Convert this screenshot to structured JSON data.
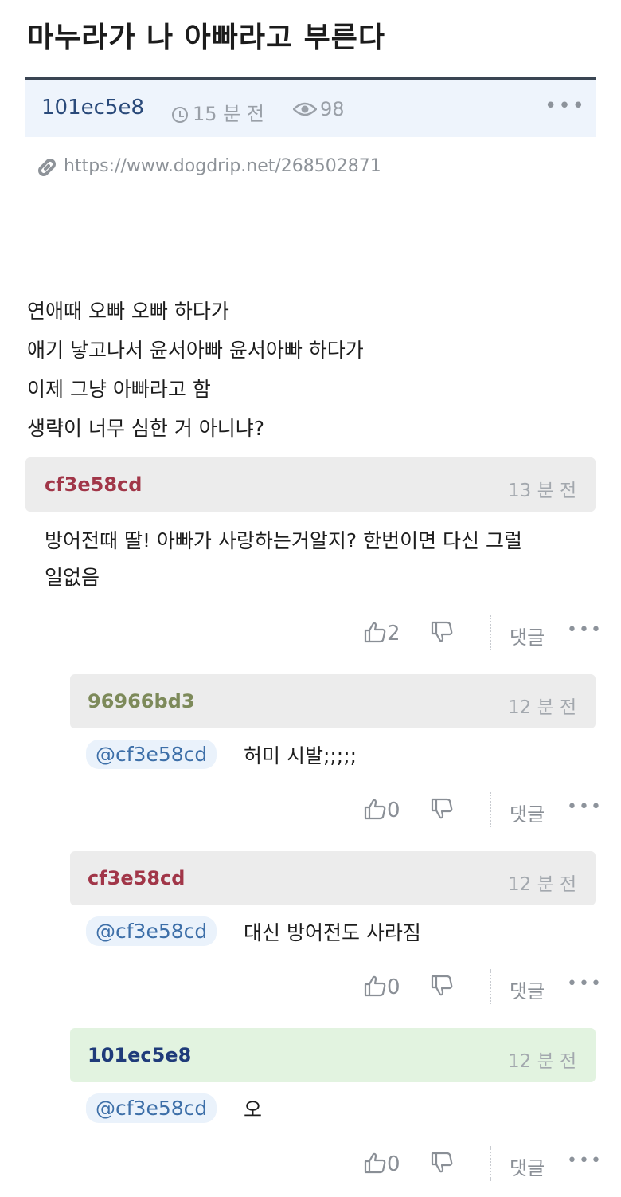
{
  "post": {
    "title": "마누라가 나 아빠라고 부른다",
    "author": "101ec5e8",
    "time": "15 분 전",
    "views": "98",
    "url": "https://www.dogdrip.net/268502871",
    "body": [
      "연애때 오빠 오빠 하다가",
      "애기 낳고나서 윤서아빠 윤서아빠 하다가",
      "이제 그냥 아빠라고 함",
      "생략이 너무 심한 거 아니냐?"
    ]
  },
  "icons": {
    "more": "more-dots-icon",
    "clock": "clock-icon",
    "eye": "eye-icon",
    "link": "link-icon",
    "like": "thumbs-up-icon",
    "dislike": "thumbs-down-icon"
  },
  "colors": {
    "title_rule": "#3a4553",
    "meta_bg": "#eef4fc",
    "comment_head_bg": "#ececec",
    "op_comment_head_bg": "#e2f3e0",
    "author_red": "#a13648",
    "author_olive": "#7d8a5a",
    "author_blue": "#1f3b7a",
    "mention_bg": "#eaf2fb"
  },
  "comments": [
    {
      "author": "cf3e58cd",
      "time": "13 분 전",
      "text_line1": "방어전때 딸! 아빠가 사랑하는거알지? 한번이면 다신 그럴",
      "text_line2": "일없음",
      "likes": "2",
      "reply_label": "댓글"
    },
    {
      "author": "96966bd3",
      "time": "12 분 전",
      "mention": "@cf3e58cd",
      "text": "허미 시발;;;;;",
      "likes": "0",
      "reply_label": "댓글"
    },
    {
      "author": "cf3e58cd",
      "time": "12 분 전",
      "mention": "@cf3e58cd",
      "text": "대신 방어전도 사라짐",
      "likes": "0",
      "reply_label": "댓글"
    },
    {
      "author": "101ec5e8",
      "time": "12 분 전",
      "mention": "@cf3e58cd",
      "text": "오",
      "likes": "0",
      "reply_label": "댓글"
    }
  ]
}
